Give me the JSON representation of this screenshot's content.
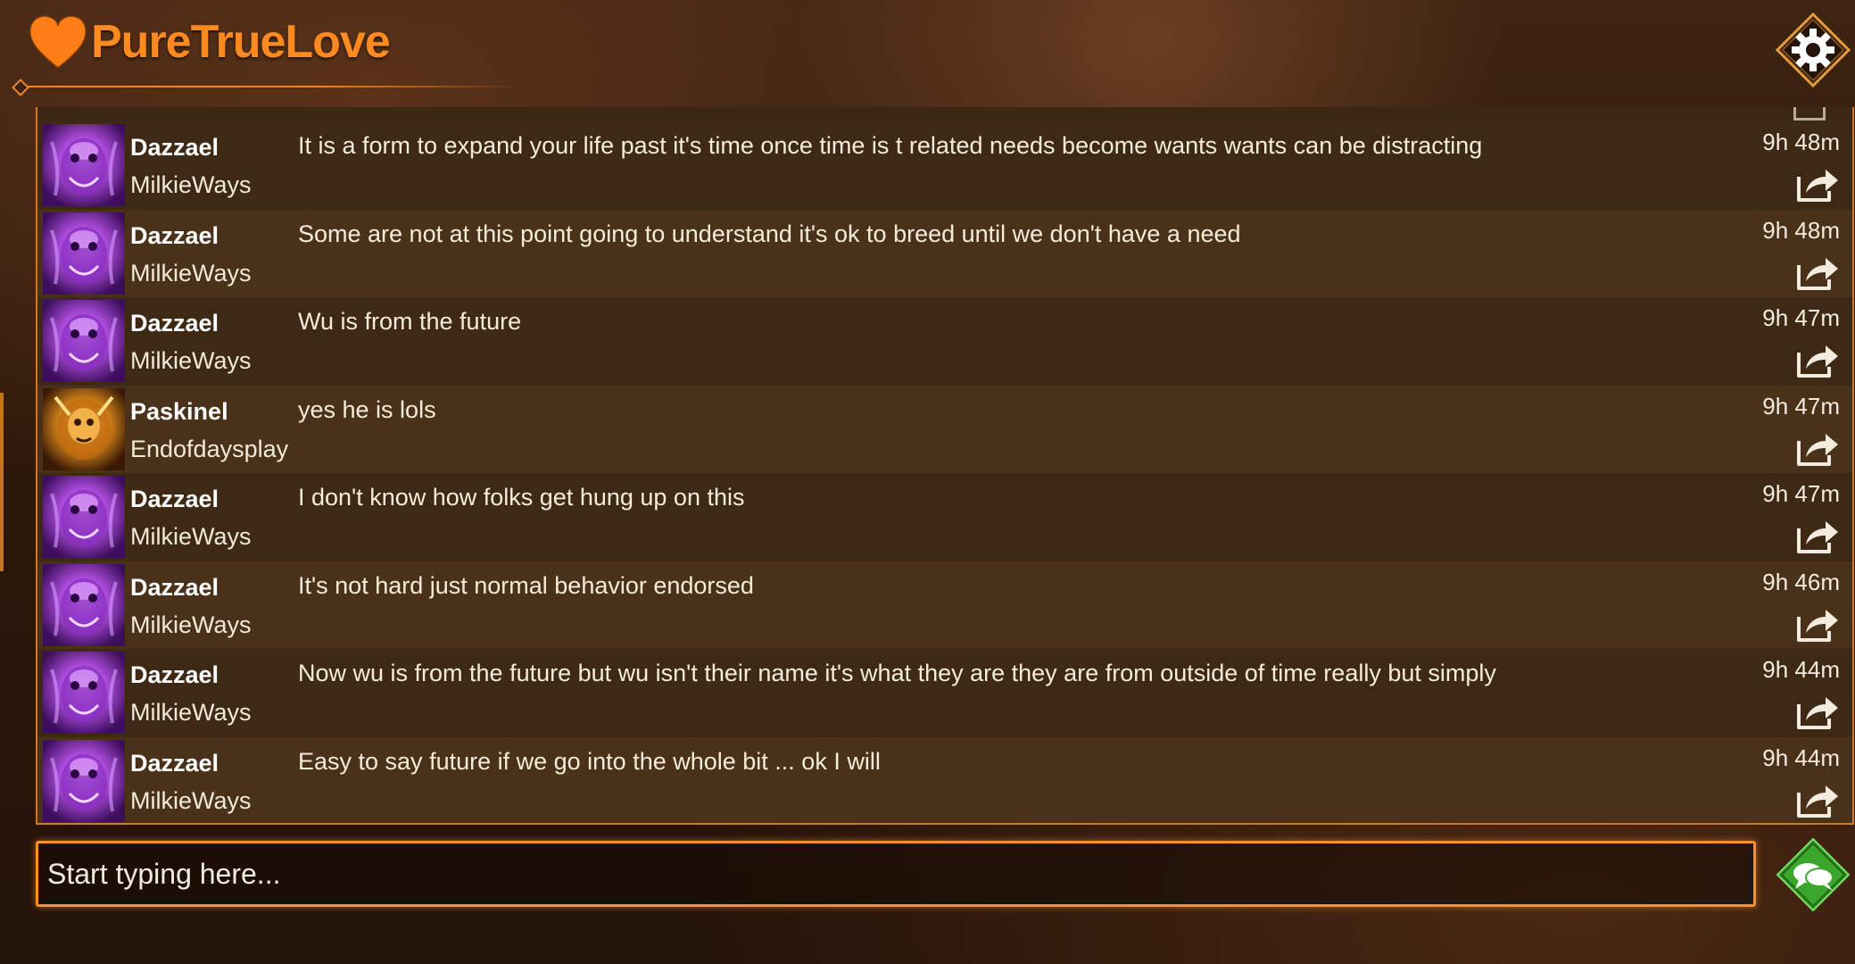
{
  "app": {
    "title": "PureTrueLove"
  },
  "header": {
    "settings_icon": "gear-icon"
  },
  "colors": {
    "accent": "#ff8a1f",
    "panel_border": "#c97a30",
    "input_border": "#ff8f26",
    "send_button": "#39a62a"
  },
  "messages": [
    {
      "author": "Dazzael",
      "account": "MilkieWays",
      "avatar": "purple-creature-avatar",
      "text": "It is a form to expand your life past it's time  once time is t related  needs become wants wants can be distracting",
      "time": "9h 48m"
    },
    {
      "author": "Dazzael",
      "account": "MilkieWays",
      "avatar": "purple-creature-avatar",
      "text": "Some are not at this point going to understand it's ok  to breed until we don't have a need",
      "time": "9h 48m"
    },
    {
      "author": "Dazzael",
      "account": "MilkieWays",
      "avatar": "purple-creature-avatar",
      "text": "Wu is from the future",
      "time": "9h 47m"
    },
    {
      "author": "Paskinel",
      "account": "Endofdaysplay",
      "avatar": "golden-lion-avatar",
      "text": "yes he is lols",
      "time": "9h 47m"
    },
    {
      "author": "Dazzael",
      "account": "MilkieWays",
      "avatar": "purple-creature-avatar",
      "text": "I don't know how folks get hung up on this",
      "time": "9h 47m"
    },
    {
      "author": "Dazzael",
      "account": "MilkieWays",
      "avatar": "purple-creature-avatar",
      "text": "It's not hard just  normal behavior endorsed",
      "time": "9h 46m"
    },
    {
      "author": "Dazzael",
      "account": "MilkieWays",
      "avatar": "purple-creature-avatar",
      "text": "Now wu is from the future but wu isn't their name it's what they are they are from outside of time really but simply",
      "time": "9h 44m"
    },
    {
      "author": "Dazzael",
      "account": "MilkieWays",
      "avatar": "purple-creature-avatar",
      "text": "Easy to say future if we go into the whole bit ... ok I will",
      "time": "9h 44m"
    }
  ],
  "composer": {
    "placeholder": "Start typing here...",
    "value": "",
    "send_icon": "chat-bubbles-icon"
  }
}
